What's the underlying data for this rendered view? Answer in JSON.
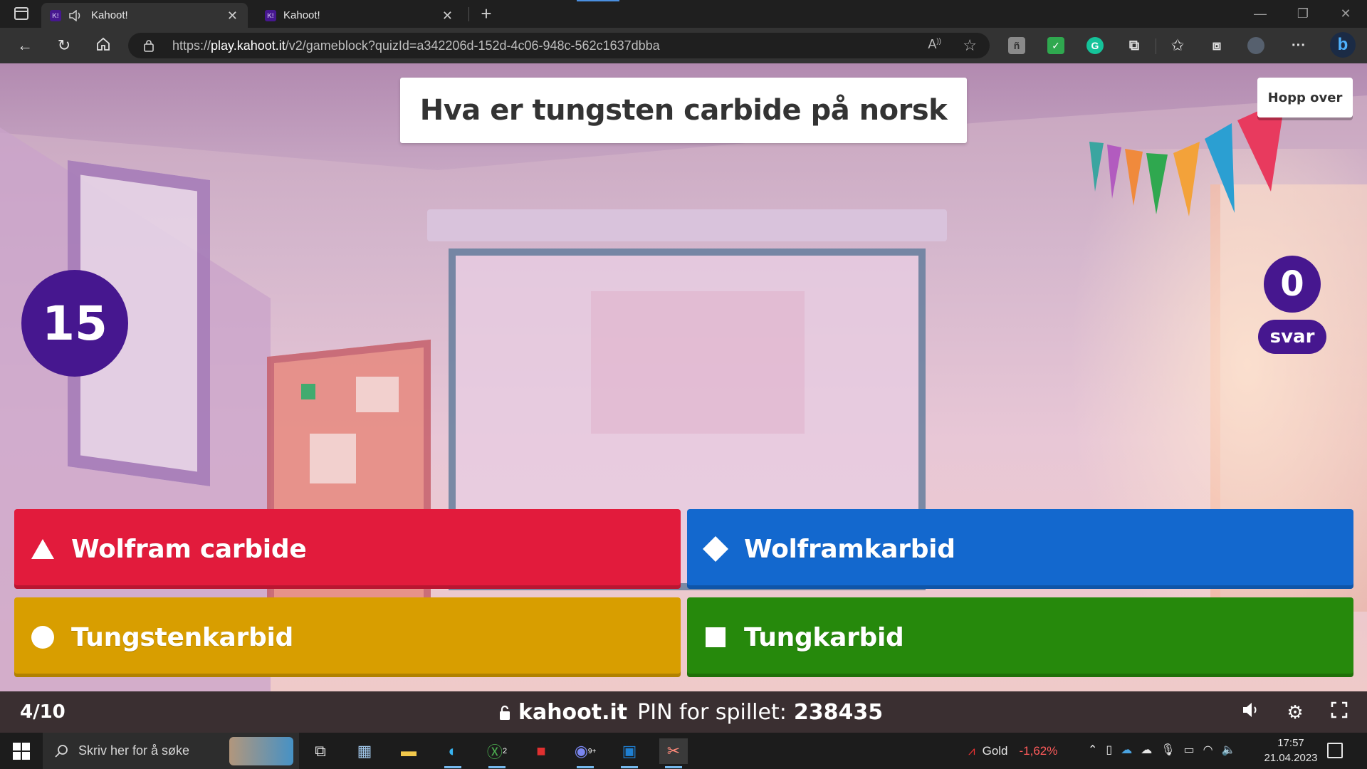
{
  "browser": {
    "tabs": [
      {
        "title": "Kahoot!",
        "active": true,
        "has_audio": true
      },
      {
        "title": "Kahoot!",
        "active": false,
        "has_audio": false
      }
    ],
    "url_scheme": "https://",
    "url_host": "play.kahoot.it",
    "url_path": "/v2/gameblock?quizId=a342206d-152d-4c06-948c-562c1637dbba"
  },
  "game": {
    "question": "Hva er tungsten carbide på norsk",
    "skip_label": "Hopp over",
    "timer": "15",
    "answer_count": "0",
    "answer_count_label": "svar",
    "answers": [
      {
        "label": "Wolfram carbide",
        "shape": "triangle",
        "color": "#e21b3c"
      },
      {
        "label": "Wolframkarbid",
        "shape": "diamond",
        "color": "#1368ce"
      },
      {
        "label": "Tungstenkarbid",
        "shape": "circle",
        "color": "#d89e00"
      },
      {
        "label": "Tungkarbid",
        "shape": "square",
        "color": "#26890c"
      }
    ],
    "progress": "4/10",
    "site": "kahoot.it",
    "pin_label": "PIN for spillet:",
    "pin": "238435",
    "accent": "#46178f"
  },
  "taskbar": {
    "search_placeholder": "Skriv her for å søke",
    "xbox_badge": "2",
    "discord_badge": "9+",
    "stock_name": "Gold",
    "stock_change": "-1,62%",
    "time": "17:57",
    "date": "21.04.2023"
  }
}
